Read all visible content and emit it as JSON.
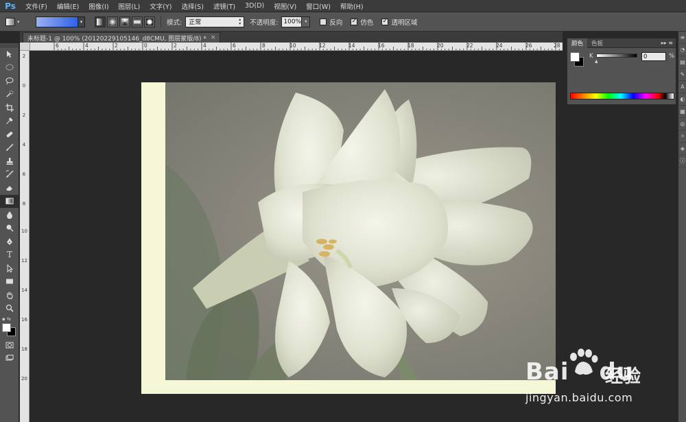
{
  "app": {
    "logo": "Ps"
  },
  "menu": [
    "文件(F)",
    "编辑(E)",
    "图像(I)",
    "图层(L)",
    "文字(Y)",
    "选择(S)",
    "滤镜(T)",
    "3D(D)",
    "视图(V)",
    "窗口(W)",
    "帮助(H)"
  ],
  "options": {
    "gradient_colors": [
      "#9bb1ee",
      "#2f62e8"
    ],
    "mode_label": "模式:",
    "mode_value": "正常",
    "opacity_label": "不透明度:",
    "opacity_value": "100%",
    "reverse_label": "反向",
    "reverse_checked": false,
    "dither_label": "仿色",
    "dither_checked": true,
    "transparency_label": "透明区域",
    "transparency_checked": true
  },
  "document": {
    "tab_title": "未标题-1 @ 100% (20120229105146_d8CMU, 图层蒙版/8) *",
    "close": "×"
  },
  "ruler": {
    "h_labels": [
      "6",
      "4",
      "2",
      "0",
      "2",
      "4",
      "6",
      "8",
      "10",
      "12",
      "14",
      "16",
      "18",
      "20",
      "22",
      "24",
      "26",
      "28"
    ],
    "v_labels": [
      "2",
      "0",
      "2",
      "4",
      "6",
      "8",
      "10",
      "12",
      "14",
      "16",
      "18",
      "20"
    ]
  },
  "color_panel": {
    "tab_color": "颜色",
    "tab_swatches": "色板",
    "menu": "▸▸ ≡",
    "channel_label": "K",
    "channel_value": "0",
    "unit": "%"
  },
  "watermark": {
    "brand": "Bai",
    "brand2": "du",
    "cn": "经验",
    "url": "jingyan.baidu.com"
  }
}
